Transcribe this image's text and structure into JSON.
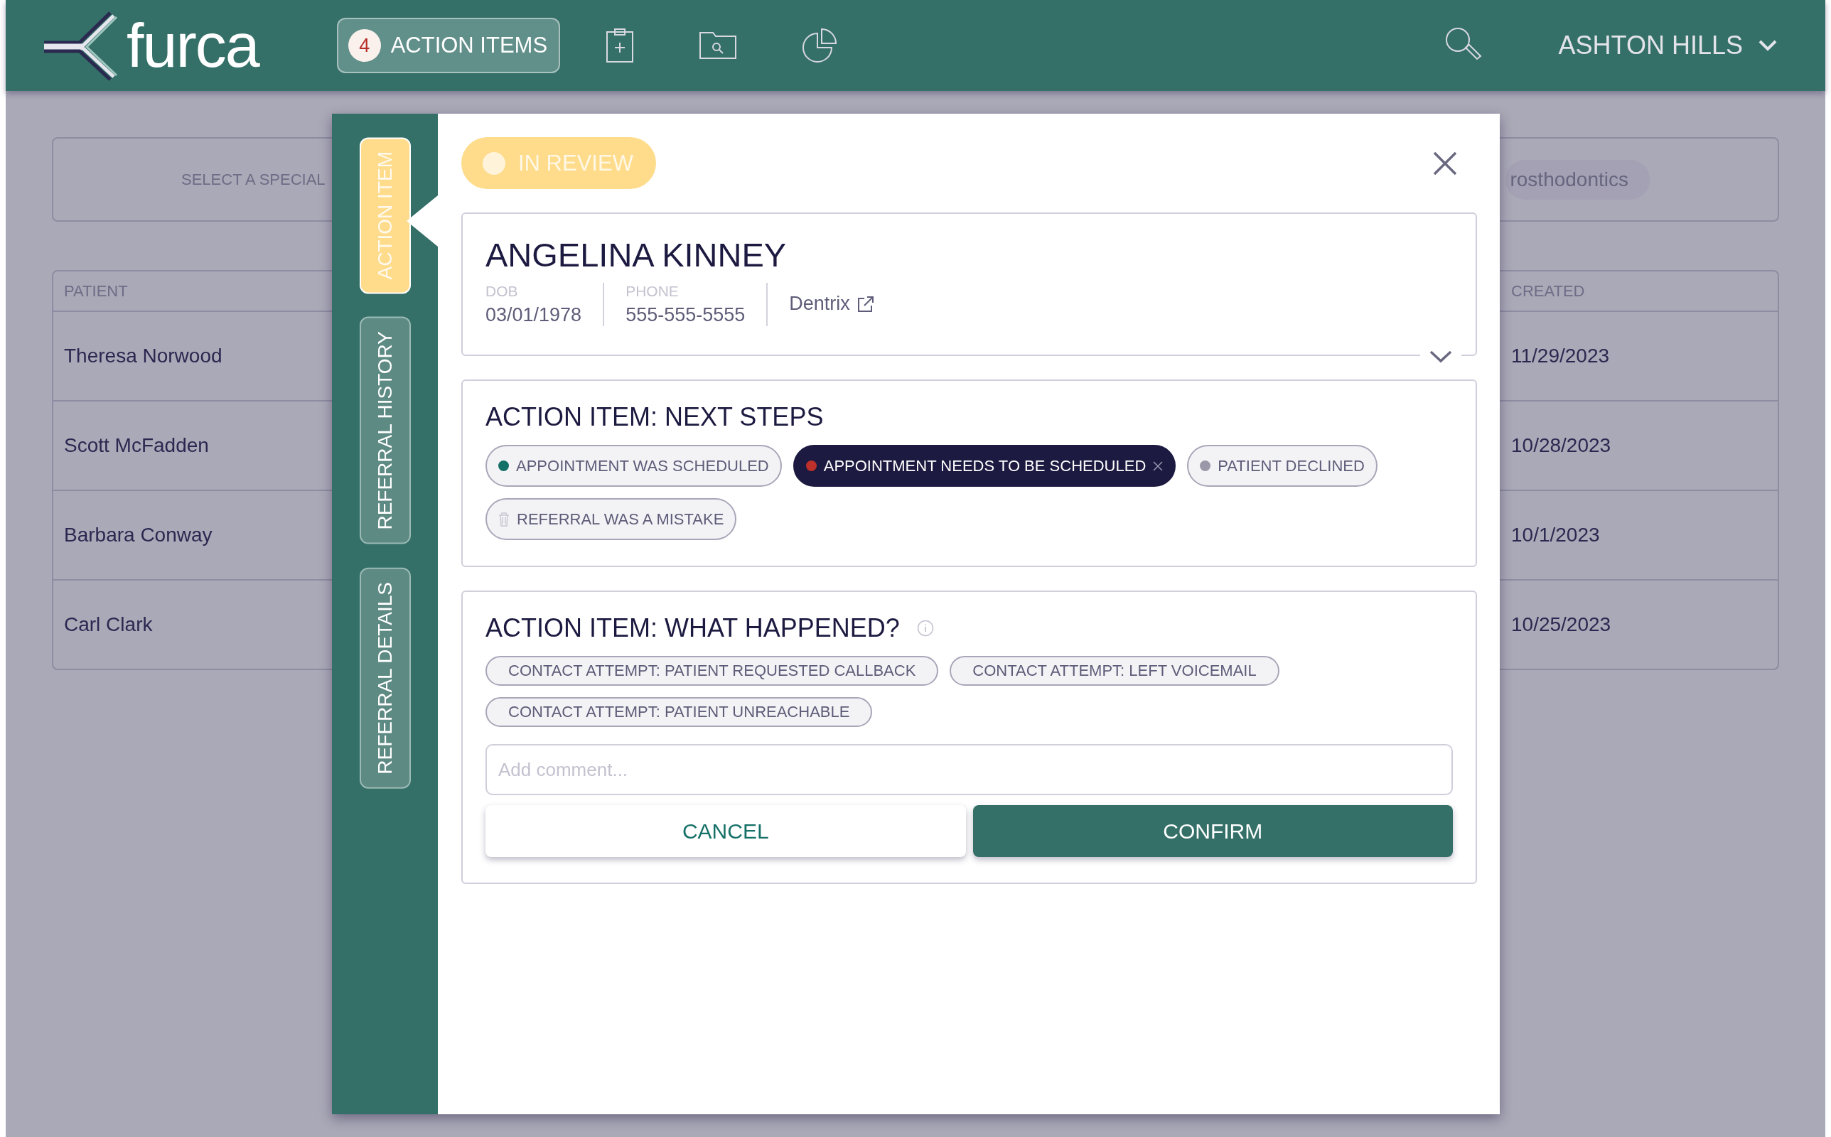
{
  "header": {
    "logo": "furca",
    "action_items": {
      "count": "4",
      "label": "ACTION ITEMS"
    },
    "user": "ASHTON HILLS"
  },
  "background": {
    "filter": {
      "label": "SELECT A SPECIAL",
      "chip": "rosthodontics"
    },
    "table": {
      "columns": [
        "PATIENT",
        "CREATED"
      ],
      "rows": [
        {
          "patient": "Theresa Norwood",
          "created": "11/29/2023"
        },
        {
          "patient": "Scott McFadden",
          "created": "10/28/2023"
        },
        {
          "patient": "Barbara Conway",
          "created": "10/1/2023"
        },
        {
          "patient": "Carl Clark",
          "created": "10/25/2023"
        }
      ]
    }
  },
  "modal": {
    "tabs": [
      {
        "label": "ACTION ITEM",
        "selected": true
      },
      {
        "label": "REFERRAL HISTORY",
        "selected": false
      },
      {
        "label": "REFERRAL DETAILS",
        "selected": false
      }
    ],
    "status": "IN REVIEW",
    "patient": {
      "name": "ANGELINA KINNEY",
      "dob_label": "DOB",
      "dob": "03/01/1978",
      "phone_label": "PHONE",
      "phone": "555-555-5555",
      "link": "Dentrix"
    },
    "next_steps": {
      "title": "ACTION ITEM: NEXT STEPS",
      "options": [
        {
          "label": "APPOINTMENT WAS SCHEDULED",
          "kind": "dot",
          "color": "#157068",
          "selected": false
        },
        {
          "label": "APPOINTMENT NEEDS TO BE SCHEDULED",
          "kind": "dot",
          "color": "#c0302a",
          "selected": true
        },
        {
          "label": "PATIENT DECLINED",
          "kind": "dot",
          "color": "#9a98a8",
          "selected": false
        },
        {
          "label": "REFERRAL WAS A MISTAKE",
          "kind": "trash",
          "selected": false
        }
      ]
    },
    "what_happened": {
      "title": "ACTION ITEM: WHAT HAPPENED?",
      "options": [
        {
          "label": "CONTACT ATTEMPT: PATIENT REQUESTED CALLBACK",
          "selected": false
        },
        {
          "label": "CONTACT ATTEMPT: LEFT VOICEMAIL",
          "selected": false
        },
        {
          "label": "CONTACT ATTEMPT: PATIENT UNREACHABLE",
          "selected": false
        }
      ]
    },
    "comment": {
      "placeholder": "Add comment..."
    },
    "buttons": {
      "cancel": "CANCEL",
      "confirm": "CONFIRM"
    }
  }
}
